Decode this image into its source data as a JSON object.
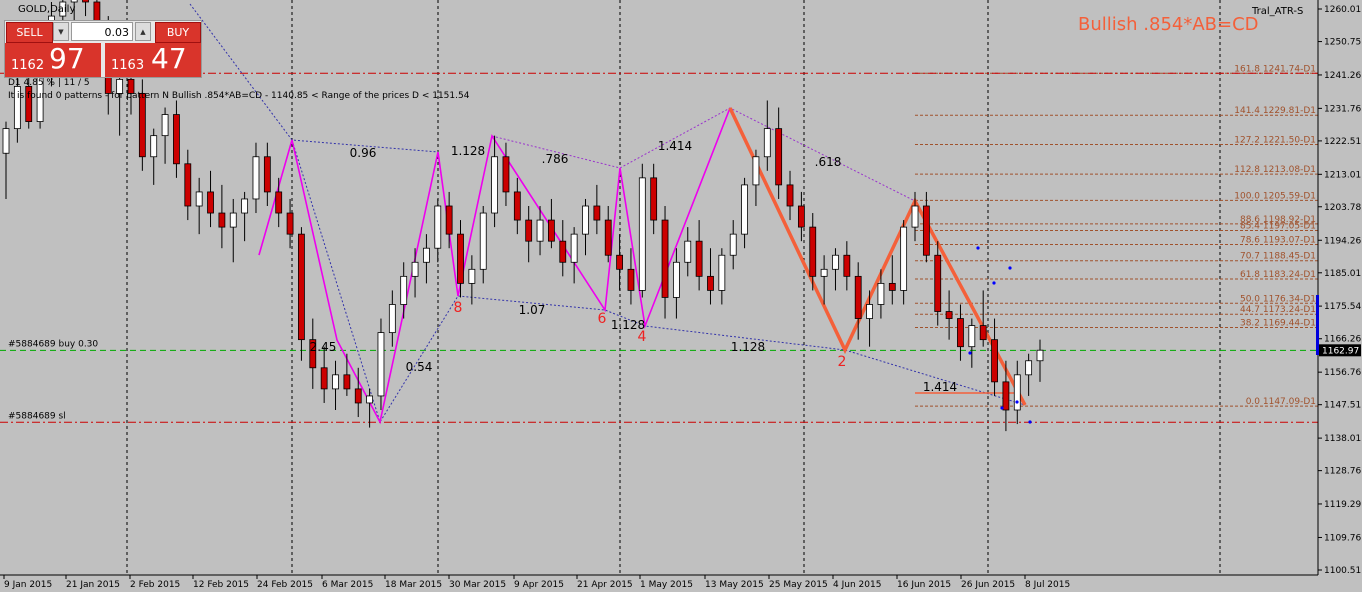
{
  "window": {
    "title": "GOLD,Daily"
  },
  "indicator": {
    "name": "Tral_ATR-S"
  },
  "pattern_title": "Bullish .854*AB=CD",
  "info_lines": [
    "D1  4.85 %  |  11 / 5",
    "It is found 0 patterns  -  for pattern N  Bullish .854*AB=CD  - 1140.85 < Range of the prices D < 1151.54"
  ],
  "trade_panel": {
    "sell_label": "SELL",
    "buy_label": "BUY",
    "lot": "0.03",
    "sell_small": "1162",
    "sell_big": "97",
    "buy_small": "1163",
    "buy_big": "47"
  },
  "order_labels": {
    "buy": "#5884689 buy 0.30",
    "sl": "#5884689 sl"
  },
  "current_price": "1162.97",
  "colors": {
    "background": "#c0c0c0",
    "bull": "#ffffff",
    "bear": "#cc0000",
    "pattern_magenta": "#ee00ee",
    "pattern_orange": "#f4603a",
    "fib": "#a0522d",
    "order": "#cc0000"
  },
  "chart_data": {
    "type": "candlestick",
    "y_axis": {
      "ticks": [
        "1260.01",
        "1250.75",
        "1241.26",
        "1231.76",
        "1222.51",
        "1213.01",
        "1203.78",
        "1194.26",
        "1185.01",
        "1175.54",
        "1166.26",
        "1156.76",
        "1147.51",
        "1138.01",
        "1128.76",
        "1119.29",
        "1109.76",
        "1100.51"
      ]
    },
    "x_axis": {
      "ticks": [
        "9 Jan 2015",
        "21 Jan 2015",
        "2 Feb 2015",
        "12 Feb 2015",
        "24 Feb 2015",
        "6 Mar 2015",
        "18 Mar 2015",
        "30 Mar 2015",
        "9 Apr 2015",
        "21 Apr 2015",
        "1 May 2015",
        "13 May 2015",
        "25 May 2015",
        "4 Jun 2015",
        "16 Jun 2015",
        "26 Jun 2015",
        "8 Jul 2015"
      ]
    },
    "fib_levels": [
      {
        "label": "161.8   1241.74-D1",
        "value": 1241.74
      },
      {
        "label": "141.4   1229.81-D1",
        "value": 1229.81
      },
      {
        "label": "127.2   1221.50-D1",
        "value": 1221.5
      },
      {
        "label": "112.8   1213.08-D1",
        "value": 1213.08
      },
      {
        "label": "100.0   1205.59-D1",
        "value": 1205.59
      },
      {
        "label": "88.6   1198.92-D1",
        "value": 1198.92
      },
      {
        "label": "85.4   1197.05-D1",
        "value": 1197.05
      },
      {
        "label": "78.6   1193.07-D1",
        "value": 1193.07
      },
      {
        "label": "70.7   1188.45-D1",
        "value": 1188.45
      },
      {
        "label": "61.8   1183.24-D1",
        "value": 1183.24
      },
      {
        "label": "50.0   1176.34-D1",
        "value": 1176.34
      },
      {
        "label": "44.7   1173.24-D1",
        "value": 1173.24
      },
      {
        "label": "38.2   1169.44-D1",
        "value": 1169.44
      },
      {
        "label": "0.0   1147.09-D1",
        "value": 1147.09
      }
    ],
    "ratio_labels": [
      "0.96",
      "1.128",
      ".786",
      "1.414",
      ".618",
      "2.45",
      "0.54",
      "1.07",
      "1.128",
      "1.128",
      "1.414"
    ],
    "point_labels": [
      "8",
      "6",
      "4",
      "2"
    ],
    "order_levels": {
      "buy": 1162.97,
      "sl": 1142.5
    },
    "resistance": 1241.74,
    "candles": [
      [
        1219,
        1228,
        1206,
        1226
      ],
      [
        1226,
        1244,
        1222,
        1238
      ],
      [
        1238,
        1246,
        1226,
        1228
      ],
      [
        1228,
        1250,
        1226,
        1245
      ],
      [
        1245,
        1262,
        1238,
        1258
      ],
      [
        1258,
        1266,
        1250,
        1262
      ],
      [
        1262,
        1268,
        1254,
        1266
      ],
      [
        1266,
        1270,
        1258,
        1262
      ],
      [
        1262,
        1266,
        1246,
        1252
      ],
      [
        1252,
        1258,
        1230,
        1236
      ],
      [
        1236,
        1246,
        1224,
        1240
      ],
      [
        1240,
        1250,
        1230,
        1236
      ],
      [
        1236,
        1240,
        1214,
        1218
      ],
      [
        1218,
        1226,
        1210,
        1224
      ],
      [
        1224,
        1232,
        1216,
        1230
      ],
      [
        1230,
        1234,
        1212,
        1216
      ],
      [
        1216,
        1220,
        1200,
        1204
      ],
      [
        1204,
        1212,
        1196,
        1208
      ],
      [
        1208,
        1214,
        1198,
        1202
      ],
      [
        1202,
        1210,
        1192,
        1198
      ],
      [
        1198,
        1206,
        1188,
        1202
      ],
      [
        1202,
        1208,
        1194,
        1206
      ],
      [
        1206,
        1222,
        1202,
        1218
      ],
      [
        1218,
        1222,
        1204,
        1208
      ],
      [
        1208,
        1212,
        1198,
        1202
      ],
      [
        1202,
        1206,
        1192,
        1196
      ],
      [
        1196,
        1198,
        1160,
        1166
      ],
      [
        1166,
        1172,
        1152,
        1158
      ],
      [
        1158,
        1164,
        1148,
        1152
      ],
      [
        1152,
        1160,
        1146,
        1156
      ],
      [
        1156,
        1162,
        1150,
        1152
      ],
      [
        1152,
        1158,
        1144,
        1148
      ],
      [
        1148,
        1152,
        1141,
        1150
      ],
      [
        1150,
        1172,
        1146,
        1168
      ],
      [
        1168,
        1180,
        1164,
        1176
      ],
      [
        1176,
        1188,
        1172,
        1184
      ],
      [
        1184,
        1192,
        1178,
        1188
      ],
      [
        1188,
        1196,
        1182,
        1192
      ],
      [
        1192,
        1206,
        1188,
        1204
      ],
      [
        1204,
        1208,
        1192,
        1196
      ],
      [
        1196,
        1200,
        1178,
        1182
      ],
      [
        1182,
        1190,
        1176,
        1186
      ],
      [
        1186,
        1204,
        1182,
        1202
      ],
      [
        1202,
        1224,
        1198,
        1218
      ],
      [
        1218,
        1222,
        1204,
        1208
      ],
      [
        1208,
        1212,
        1196,
        1200
      ],
      [
        1200,
        1204,
        1188,
        1194
      ],
      [
        1194,
        1204,
        1190,
        1200
      ],
      [
        1200,
        1206,
        1192,
        1194
      ],
      [
        1194,
        1200,
        1184,
        1188
      ],
      [
        1188,
        1198,
        1182,
        1196
      ],
      [
        1196,
        1206,
        1190,
        1204
      ],
      [
        1204,
        1210,
        1196,
        1200
      ],
      [
        1200,
        1204,
        1188,
        1190
      ],
      [
        1190,
        1196,
        1180,
        1186
      ],
      [
        1186,
        1192,
        1176,
        1180
      ],
      [
        1180,
        1216,
        1178,
        1212
      ],
      [
        1212,
        1216,
        1196,
        1200
      ],
      [
        1200,
        1204,
        1172,
        1178
      ],
      [
        1178,
        1192,
        1172,
        1188
      ],
      [
        1188,
        1198,
        1184,
        1194
      ],
      [
        1194,
        1200,
        1180,
        1184
      ],
      [
        1184,
        1192,
        1176,
        1180
      ],
      [
        1180,
        1192,
        1176,
        1190
      ],
      [
        1190,
        1200,
        1186,
        1196
      ],
      [
        1196,
        1212,
        1192,
        1210
      ],
      [
        1210,
        1220,
        1204,
        1218
      ],
      [
        1218,
        1234,
        1214,
        1226
      ],
      [
        1226,
        1232,
        1206,
        1210
      ],
      [
        1210,
        1214,
        1200,
        1204
      ],
      [
        1204,
        1208,
        1194,
        1198
      ],
      [
        1198,
        1202,
        1180,
        1184
      ],
      [
        1184,
        1190,
        1176,
        1186
      ],
      [
        1186,
        1192,
        1180,
        1190
      ],
      [
        1190,
        1194,
        1180,
        1184
      ],
      [
        1184,
        1188,
        1166,
        1172
      ],
      [
        1172,
        1180,
        1164,
        1176
      ],
      [
        1176,
        1186,
        1172,
        1182
      ],
      [
        1182,
        1190,
        1176,
        1180
      ],
      [
        1180,
        1200,
        1176,
        1198
      ],
      [
        1198,
        1208,
        1194,
        1204
      ],
      [
        1204,
        1208,
        1188,
        1190
      ],
      [
        1190,
        1194,
        1170,
        1174
      ],
      [
        1174,
        1180,
        1166,
        1172
      ],
      [
        1172,
        1176,
        1160,
        1164
      ],
      [
        1164,
        1172,
        1158,
        1170
      ],
      [
        1170,
        1180,
        1164,
        1166
      ],
      [
        1166,
        1172,
        1150,
        1154
      ],
      [
        1154,
        1160,
        1140,
        1146
      ],
      [
        1146,
        1160,
        1142,
        1156
      ],
      [
        1156,
        1162,
        1150,
        1160
      ],
      [
        1160,
        1166,
        1154,
        1163
      ]
    ]
  }
}
